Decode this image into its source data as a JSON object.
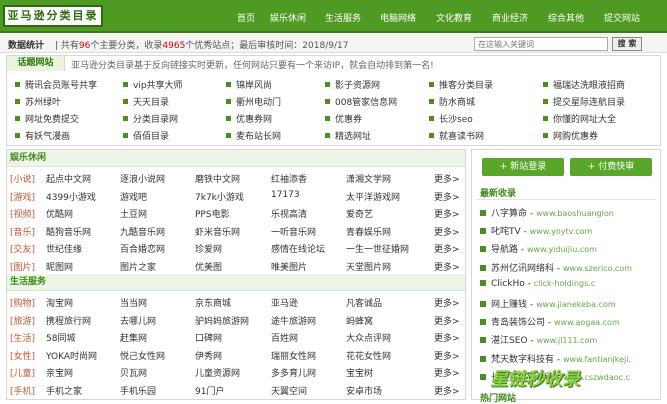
{
  "header": {
    "logo": "亚马逊分类目录",
    "nav": [
      "首页",
      "娱乐休闲",
      "生活服务",
      "电脑网络",
      "文化教育",
      "商业经济",
      "综合其他",
      "提交网站"
    ]
  },
  "stats": {
    "label": "数据统计",
    "text_a": "共有",
    "cats": "96",
    "text_b": "个主要分类，收录",
    "sites": "4965",
    "text_c": "个优秀站点；最后审核时间：2018/9/17"
  },
  "search": {
    "placeholder": "在这输入关键词",
    "button": "搜 索"
  },
  "hot": {
    "tag": "话题网站",
    "note": "亚马逊分类目录基于反向链接实时更新，任何网站只要有一个来访IP，就会自动排到第一名!",
    "rows": [
      [
        "腾讯会员账号共享",
        "vip共享大师",
        "锦岸风尚",
        "影子资源网",
        "推客分类目录",
        "福瑞达洗眼液招商"
      ],
      [
        "苏州绿叶",
        "天天目录",
        "衢州电动门",
        "008管家信息网",
        "防水商城",
        "提交星际连航目录"
      ],
      [
        "网址免费提交",
        "分类目录网",
        "优惠券网",
        "优惠券",
        "长沙seo",
        "你懂的网址大全"
      ],
      [
        "有妖气漫画",
        "佰佰目录",
        "麦布站长网",
        "精选网址",
        "就喜读书网",
        "网购优惠券"
      ]
    ]
  },
  "sections": {
    "entertainment": "娱乐休闲",
    "life": "生活服务"
  },
  "ent_rows": [
    {
      "tag": "[小说]",
      "items": [
        "起点中文网",
        "逐浪小说网",
        "磨铁中文网",
        "红袖添香",
        "潇湘文学网"
      ],
      "more": "更多>"
    },
    {
      "tag": "[游戏]",
      "items": [
        "4399小游戏",
        "游戏吧",
        "7k7k小游戏",
        "17173",
        "太平洋游戏网"
      ],
      "more": "更多>"
    },
    {
      "tag": "[视频]",
      "items": [
        "优酷网",
        "土豆网",
        "PPS电影",
        "乐视高清",
        "爱奇艺"
      ],
      "more": "更多>"
    },
    {
      "tag": "[音乐]",
      "items": [
        "酷狗音乐网",
        "九酷音乐网",
        "虾米音乐网",
        "一听音乐网",
        "青春娱乐网"
      ],
      "more": "更多>"
    },
    {
      "tag": "[交友]",
      "items": [
        "世纪佳缘",
        "百合婚恋网",
        "珍爱网",
        "感情在线论坛",
        "一生一世征婚网"
      ],
      "more": "更多>"
    },
    {
      "tag": "[图片]",
      "items": [
        "昵图网",
        "图片之家",
        "优美图",
        "唯美图片",
        "天堂图片网"
      ],
      "more": "更多>"
    }
  ],
  "life_rows": [
    {
      "tag": "[购物]",
      "items": [
        "淘宝网",
        "当当网",
        "京东商城",
        "亚马逊",
        "凡客诚品"
      ],
      "more": "更多>"
    },
    {
      "tag": "[旅游]",
      "items": [
        "携程旅行网",
        "去哪儿网",
        "驴妈妈旅游网",
        "途牛旅游网",
        "蚂蜂窝"
      ],
      "more": "更多>"
    },
    {
      "tag": "[生活]",
      "items": [
        "58同城",
        "赶集网",
        "口碑网",
        "百姓网",
        "大众点评网"
      ],
      "more": "更多>"
    },
    {
      "tag": "[女性]",
      "items": [
        "YOKA时尚网",
        "悦己女性网",
        "伊秀网",
        "瑞丽女性网",
        "花花女性网"
      ],
      "more": "更多>"
    },
    {
      "tag": "[儿童]",
      "items": [
        "亲宝网",
        "贝瓦网",
        "儿童资源网",
        "多多育儿网",
        "宝宝树"
      ],
      "more": "更多>"
    },
    {
      "tag": "[手机]",
      "items": [
        "手机之家",
        "手机乐园",
        "91门户",
        "天翼空间",
        "安卓市场"
      ],
      "more": "更多>"
    }
  ],
  "sidebar": {
    "btn_login": "+ 新站登录",
    "btn_pay": "+ 付费快审",
    "title": "最新收录",
    "bottom_title": "热门网站",
    "items": [
      {
        "name": "八字算命",
        "url": "www.baoshuanglon"
      },
      {
        "name": "叱咤TV",
        "url": "www.yoytv.com"
      },
      {
        "name": "导航路",
        "url": "www.yiduijiu.com"
      },
      {
        "name": "苏州亿讯网络科",
        "url": "www.szerico.com"
      },
      {
        "name": "ClickHo",
        "url": "click-holdings.c"
      },
      {
        "name": "网上赚钱",
        "url": "www.jianekeba.com"
      },
      {
        "name": "青岛装饰公司",
        "url": "www.aogaa.com"
      },
      {
        "name": "湛江SEO",
        "url": "www.jl111.com"
      },
      {
        "name": "梵天数字科技有",
        "url": "www.fantianjkeji."
      },
      {
        "name": "长沙财经管培训",
        "url": "www.cszwdaoc.c"
      }
    ]
  },
  "watermark": "星链秒收录"
}
